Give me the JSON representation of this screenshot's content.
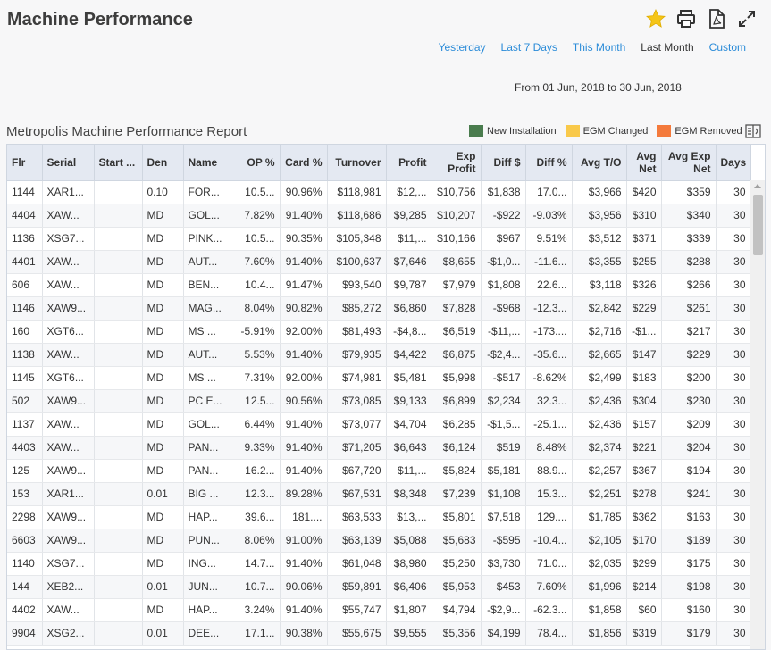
{
  "header": {
    "title": "Machine Performance"
  },
  "toolbar": {
    "icons": [
      "star-icon",
      "print-icon",
      "pdf-icon",
      "expand-icon"
    ],
    "star_color": "#f5c518"
  },
  "date_ranges": [
    {
      "label": "Yesterday",
      "active": false
    },
    {
      "label": "Last 7 Days",
      "active": false
    },
    {
      "label": "This Month",
      "active": false
    },
    {
      "label": "Last Month",
      "active": true
    },
    {
      "label": "Custom",
      "active": false
    }
  ],
  "date_range_text": "From 01 Jun, 2018 to 30 Jun, 2018",
  "report": {
    "title": "Metropolis Machine Performance Report"
  },
  "legend": [
    {
      "label": "New Installation",
      "color": "#4a7c4e"
    },
    {
      "label": "EGM Changed",
      "color": "#f9c94a"
    },
    {
      "label": "EGM Removed",
      "color": "#f47a3c"
    }
  ],
  "table": {
    "columns": [
      "Flr",
      "Serial",
      "Start ...",
      "Den",
      "Name",
      "OP %",
      "Card %",
      "Turnover",
      "Profit",
      "Exp Profit",
      "Diff $",
      "Diff %",
      "Avg T/O",
      "Avg Net",
      "Avg Exp Net",
      "Days"
    ],
    "rows": [
      [
        "1144",
        "XAR1...",
        "",
        "0.10",
        "FOR...",
        "10.5...",
        "90.96%",
        "$118,981",
        "$12,...",
        "$10,756",
        "$1,838",
        "17.0...",
        "$3,966",
        "$420",
        "$359",
        "30"
      ],
      [
        "4404",
        "XAW...",
        "",
        "MD",
        "GOL...",
        "7.82%",
        "91.40%",
        "$118,686",
        "$9,285",
        "$10,207",
        "-$922",
        "-9.03%",
        "$3,956",
        "$310",
        "$340",
        "30"
      ],
      [
        "1136",
        "XSG7...",
        "",
        "MD",
        "PINK...",
        "10.5...",
        "90.35%",
        "$105,348",
        "$11,...",
        "$10,166",
        "$967",
        "9.51%",
        "$3,512",
        "$371",
        "$339",
        "30"
      ],
      [
        "4401",
        "XAW...",
        "",
        "MD",
        "AUT...",
        "7.60%",
        "91.40%",
        "$100,637",
        "$7,646",
        "$8,655",
        "-$1,0...",
        "-11.6...",
        "$3,355",
        "$255",
        "$288",
        "30"
      ],
      [
        "606",
        "XAW...",
        "",
        "MD",
        "BEN...",
        "10.4...",
        "91.47%",
        "$93,540",
        "$9,787",
        "$7,979",
        "$1,808",
        "22.6...",
        "$3,118",
        "$326",
        "$266",
        "30"
      ],
      [
        "1146",
        "XAW9...",
        "",
        "MD",
        "MAG...",
        "8.04%",
        "90.82%",
        "$85,272",
        "$6,860",
        "$7,828",
        "-$968",
        "-12.3...",
        "$2,842",
        "$229",
        "$261",
        "30"
      ],
      [
        "160",
        "XGT6...",
        "",
        "MD",
        "MS ...",
        "-5.91%",
        "92.00%",
        "$81,493",
        "-$4,8...",
        "$6,519",
        "-$11,...",
        "-173....",
        "$2,716",
        "-$1...",
        "$217",
        "30"
      ],
      [
        "1138",
        "XAW...",
        "",
        "MD",
        "AUT...",
        "5.53%",
        "91.40%",
        "$79,935",
        "$4,422",
        "$6,875",
        "-$2,4...",
        "-35.6...",
        "$2,665",
        "$147",
        "$229",
        "30"
      ],
      [
        "1145",
        "XGT6...",
        "",
        "MD",
        "MS ...",
        "7.31%",
        "92.00%",
        "$74,981",
        "$5,481",
        "$5,998",
        "-$517",
        "-8.62%",
        "$2,499",
        "$183",
        "$200",
        "30"
      ],
      [
        "502",
        "XAW9...",
        "",
        "MD",
        "PC E...",
        "12.5...",
        "90.56%",
        "$73,085",
        "$9,133",
        "$6,899",
        "$2,234",
        "32.3...",
        "$2,436",
        "$304",
        "$230",
        "30"
      ],
      [
        "1137",
        "XAW...",
        "",
        "MD",
        "GOL...",
        "6.44%",
        "91.40%",
        "$73,077",
        "$4,704",
        "$6,285",
        "-$1,5...",
        "-25.1...",
        "$2,436",
        "$157",
        "$209",
        "30"
      ],
      [
        "4403",
        "XAW...",
        "",
        "MD",
        "PAN...",
        "9.33%",
        "91.40%",
        "$71,205",
        "$6,643",
        "$6,124",
        "$519",
        "8.48%",
        "$2,374",
        "$221",
        "$204",
        "30"
      ],
      [
        "125",
        "XAW9...",
        "",
        "MD",
        "PAN...",
        "16.2...",
        "91.40%",
        "$67,720",
        "$11,...",
        "$5,824",
        "$5,181",
        "88.9...",
        "$2,257",
        "$367",
        "$194",
        "30"
      ],
      [
        "153",
        "XAR1...",
        "",
        "0.01",
        "BIG ...",
        "12.3...",
        "89.28%",
        "$67,531",
        "$8,348",
        "$7,239",
        "$1,108",
        "15.3...",
        "$2,251",
        "$278",
        "$241",
        "30"
      ],
      [
        "2298",
        "XAW9...",
        "",
        "MD",
        "HAP...",
        "39.6...",
        "181....",
        "$63,533",
        "$13,...",
        "$5,801",
        "$7,518",
        "129....",
        "$1,785",
        "$362",
        "$163",
        "30"
      ],
      [
        "6603",
        "XAW9...",
        "",
        "MD",
        "PUN...",
        "8.06%",
        "91.00%",
        "$63,139",
        "$5,088",
        "$5,683",
        "-$595",
        "-10.4...",
        "$2,105",
        "$170",
        "$189",
        "30"
      ],
      [
        "1140",
        "XSG7...",
        "",
        "MD",
        "ING...",
        "14.7...",
        "91.40%",
        "$61,048",
        "$8,980",
        "$5,250",
        "$3,730",
        "71.0...",
        "$2,035",
        "$299",
        "$175",
        "30"
      ],
      [
        "144",
        "XEB2...",
        "",
        "0.01",
        "JUN...",
        "10.7...",
        "90.06%",
        "$59,891",
        "$6,406",
        "$5,953",
        "$453",
        "7.60%",
        "$1,996",
        "$214",
        "$198",
        "30"
      ],
      [
        "4402",
        "XAW...",
        "",
        "MD",
        "HAP...",
        "3.24%",
        "91.40%",
        "$55,747",
        "$1,807",
        "$4,794",
        "-$2,9...",
        "-62.3...",
        "$1,858",
        "$60",
        "$160",
        "30"
      ],
      [
        "9904",
        "XSG2...",
        "",
        "0.01",
        "DEE...",
        "17.1...",
        "90.38%",
        "$55,675",
        "$9,555",
        "$5,356",
        "$4,199",
        "78.4...",
        "$1,856",
        "$319",
        "$179",
        "30"
      ]
    ]
  }
}
